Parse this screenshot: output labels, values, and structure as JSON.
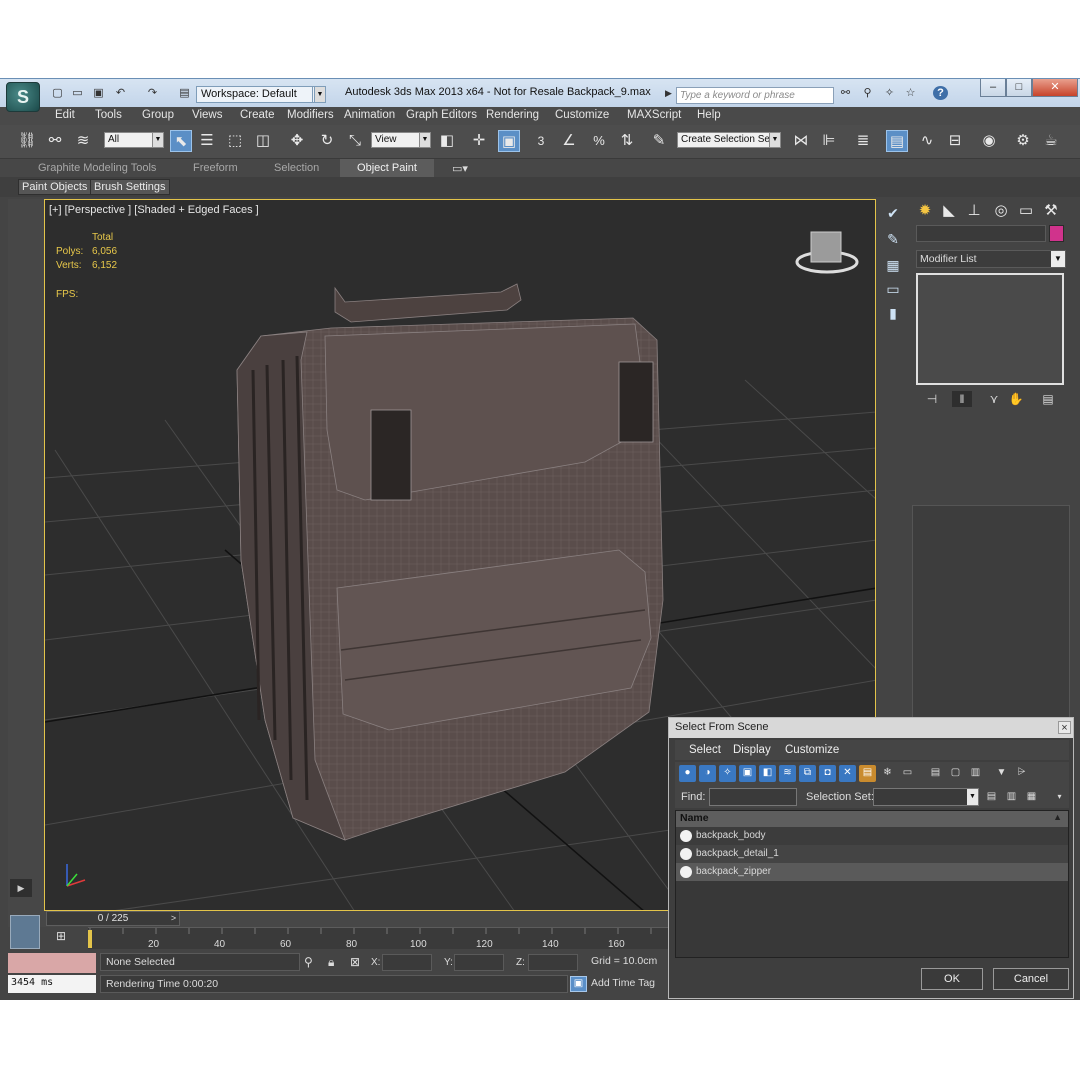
{
  "titlebar": {
    "workspace": "Workspace: Default",
    "title": "Autodesk 3ds Max  2013 x64   - Not for Resale      Backpack_9.max",
    "search_placeholder": "Type a keyword or phrase",
    "help_icon": "?",
    "min": "–",
    "max": "□",
    "close": "✕"
  },
  "menu": [
    "Edit",
    "Tools",
    "Group",
    "Views",
    "Create",
    "Modifiers",
    "Animation",
    "Graph Editors",
    "Rendering",
    "Customize",
    "MAXScript",
    "Help"
  ],
  "toolbar": {
    "filter": "All",
    "refcoord": "View",
    "selection_set": "Create Selection Se",
    "snap_label": "3",
    "angle_label": "∠",
    "percent_label": "%"
  },
  "ribbon": {
    "tabs": [
      "Graphite Modeling Tools",
      "Freeform",
      "Selection",
      "Object Paint"
    ],
    "active_tab": "Object Paint",
    "sub_buttons": [
      "Paint Objects",
      "Brush Settings"
    ]
  },
  "viewport": {
    "label": "[+] [Perspective ] [Shaded + Edged Faces ]",
    "stats": {
      "total_label": "Total",
      "polys_label": "Polys:",
      "polys": "6,056",
      "verts_label": "Verts:",
      "verts": "6,152",
      "fps_label": "FPS:"
    },
    "accent": "#e3c44a"
  },
  "command_panel": {
    "modifier_list": "Modifier List",
    "object_color": "#d0338c"
  },
  "timeline": {
    "slider": "0 / 225",
    "ticks": [
      "20",
      "40",
      "60",
      "80",
      "100",
      "120",
      "140",
      "160"
    ]
  },
  "status": {
    "selection": "None Selected",
    "render_time": "Rendering Time  0:00:20",
    "render_ms": "3454 ms",
    "x_label": "X:",
    "y_label": "Y:",
    "z_label": "Z:",
    "grid": "Grid = 10.0cm",
    "add_time_tag": "Add Time Tag"
  },
  "dialog": {
    "title": "Select From Scene",
    "menu": [
      "Select",
      "Display",
      "Customize"
    ],
    "find_label": "Find:",
    "selection_set_label": "Selection Set:",
    "column_name": "Name",
    "items": [
      "backpack_body",
      "backpack_detail_1",
      "backpack_zipper"
    ],
    "ok": "OK",
    "cancel": "Cancel"
  }
}
